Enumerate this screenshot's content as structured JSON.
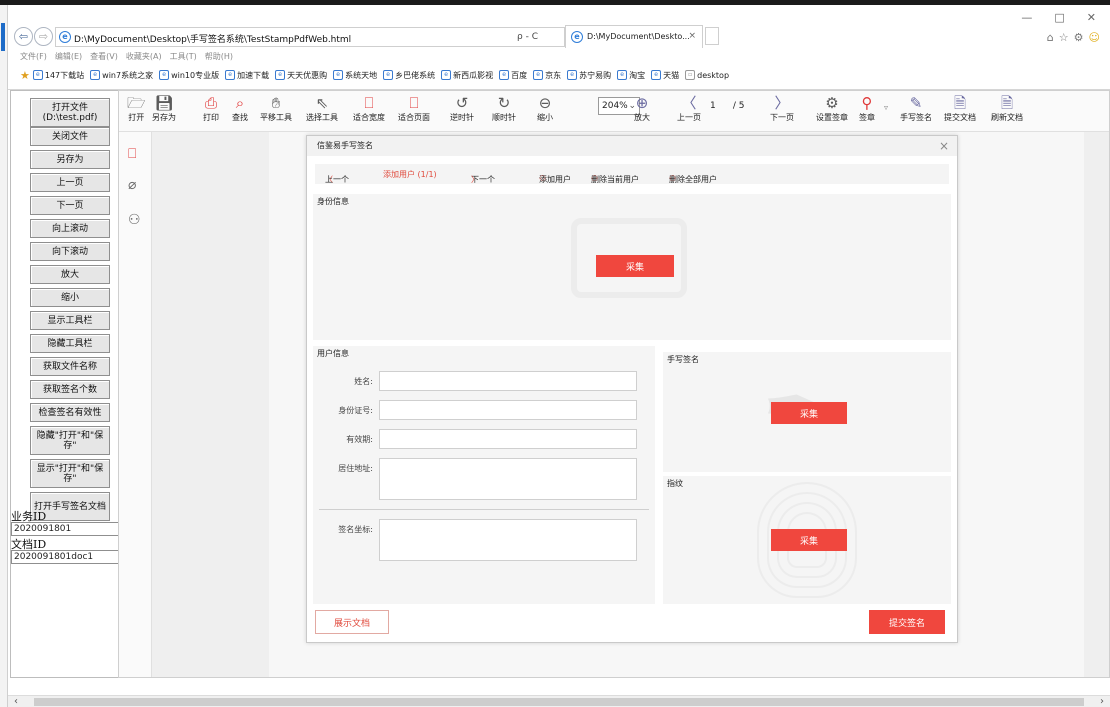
{
  "browser": {
    "address": "D:\\MyDocument\\Desktop\\手写签名系统\\TestStampPdfWeb.html",
    "search_hint": "ρ - C",
    "tab_title": "D:\\MyDocument\\Deskto...",
    "tab_close": "×",
    "menu": [
      "文件(F)",
      "编辑(E)",
      "查看(V)",
      "收藏夹(A)",
      "工具(T)",
      "帮助(H)"
    ],
    "favorites": [
      "147下载站",
      "win7系统之家",
      "win10专业版",
      "加速下载",
      "天天优惠购",
      "系统天地",
      "乡巴佬系统",
      "新西瓜影视",
      "百度",
      "京东",
      "苏宁易购",
      "淘宝",
      "天猫",
      "desktop"
    ],
    "window_controls": [
      "—",
      "□",
      "✕"
    ],
    "right_icons": [
      "⌂",
      "☆",
      "⚙",
      "☺"
    ]
  },
  "left_panel": {
    "buttons": [
      "打开文件\n(D:\\test.pdf)",
      "关闭文件",
      "另存为",
      "上一页",
      "下一页",
      "向上滚动",
      "向下滚动",
      "放大",
      "缩小",
      "显示工具栏",
      "隐藏工具栏",
      "获取文件名称",
      "获取签名个数",
      "检查签名有效性",
      "隐藏\"打开\"和\"保存\"",
      "显示\"打开\"和\"保存\"",
      "打开手写签名文档"
    ],
    "business_id_label": "业务ID",
    "business_id_value": "2020091801",
    "doc_id_label": "文档ID",
    "doc_id_value": "2020091801doc1"
  },
  "toolbar": {
    "open": "打开",
    "save_as": "另存为",
    "print": "打印",
    "find": "查找",
    "pan": "平移工具",
    "select": "选择工具",
    "fit_width": "适合宽度",
    "fit_page": "适合页面",
    "rotate_ccw": "逆时针",
    "rotate_cw": "顺时针",
    "zoom_out": "缩小",
    "zoom_value": "204%",
    "zoom_in": "放大",
    "prev_page": "上一页",
    "page_current": "1",
    "page_total": "/ 5",
    "next_page": "下一页",
    "sign_settings": "设置签章",
    "stamp": "签章",
    "handwrite": "手写签名",
    "submit_doc": "提交文档",
    "refresh_doc": "刷新文档"
  },
  "dialog": {
    "title": "信鉴易手写签名",
    "prev": "上一个",
    "current_user": "添加用户 (1/1)",
    "next": "下一个",
    "add_user": "添加用户",
    "delete_current": "删除当前用户",
    "delete_all": "删除全部用户",
    "identity_title": "身份信息",
    "collect": "采集",
    "user_info_title": "用户信息",
    "fields": {
      "name": "姓名:",
      "id_number": "身份证号:",
      "valid_period": "有效期:",
      "address": "居住地址:",
      "sign_coord": "签名坐标:"
    },
    "handwrite_title": "手写签名",
    "fingerprint_title": "指纹",
    "show_doc": "展示文档",
    "submit_sign": "提交签名"
  },
  "colors": {
    "accent_red": "#f0473e",
    "ie_blue": "#2f7dd8"
  }
}
